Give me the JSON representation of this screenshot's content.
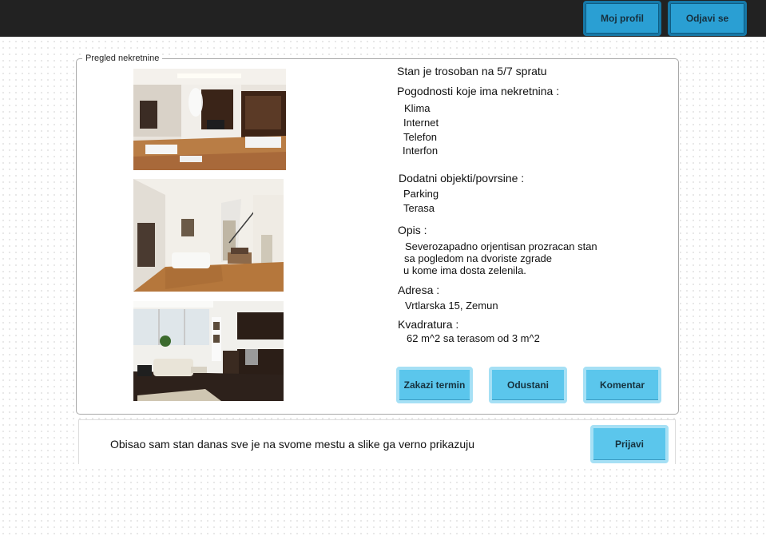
{
  "header": {
    "profile_label": "Moj profil",
    "logout_label": "Odjavi se"
  },
  "panel": {
    "legend": "Pregled nekretnine",
    "headline": "Stan je trosoban na 5/7 spratu",
    "amenities_title": "Pogodnosti koje ima nekretnina :",
    "amenities": [
      "Klima",
      "Internet",
      "Telefon",
      "Interfon"
    ],
    "extras_title": "Dodatni objekti/povrsine :",
    "extras": [
      "Parking",
      "Terasa"
    ],
    "description_title": "Opis :",
    "description_lines": [
      "Severozapadno orjentisan prozracan stan",
      "sa pogledom na dvoriste zgrade",
      "u kome ima dosta zelenila."
    ],
    "address_title": "Adresa :",
    "address": "Vrtlarska 15, Zemun",
    "area_title": "Kvadratura :",
    "area": "62 m^2 sa terasom od 3 m^2",
    "buttons": {
      "schedule": "Zakazi termin",
      "cancel": "Odustani",
      "comment": "Komentar"
    }
  },
  "comment": {
    "text": "Obisao sam stan danas sve je na svome mestu a slike ga verno prikazuju",
    "report_label": "Prijavi"
  },
  "colors": {
    "topbar": "#222222",
    "button_dark": "#2a9fd3",
    "button_light": "#5bc6ec"
  }
}
